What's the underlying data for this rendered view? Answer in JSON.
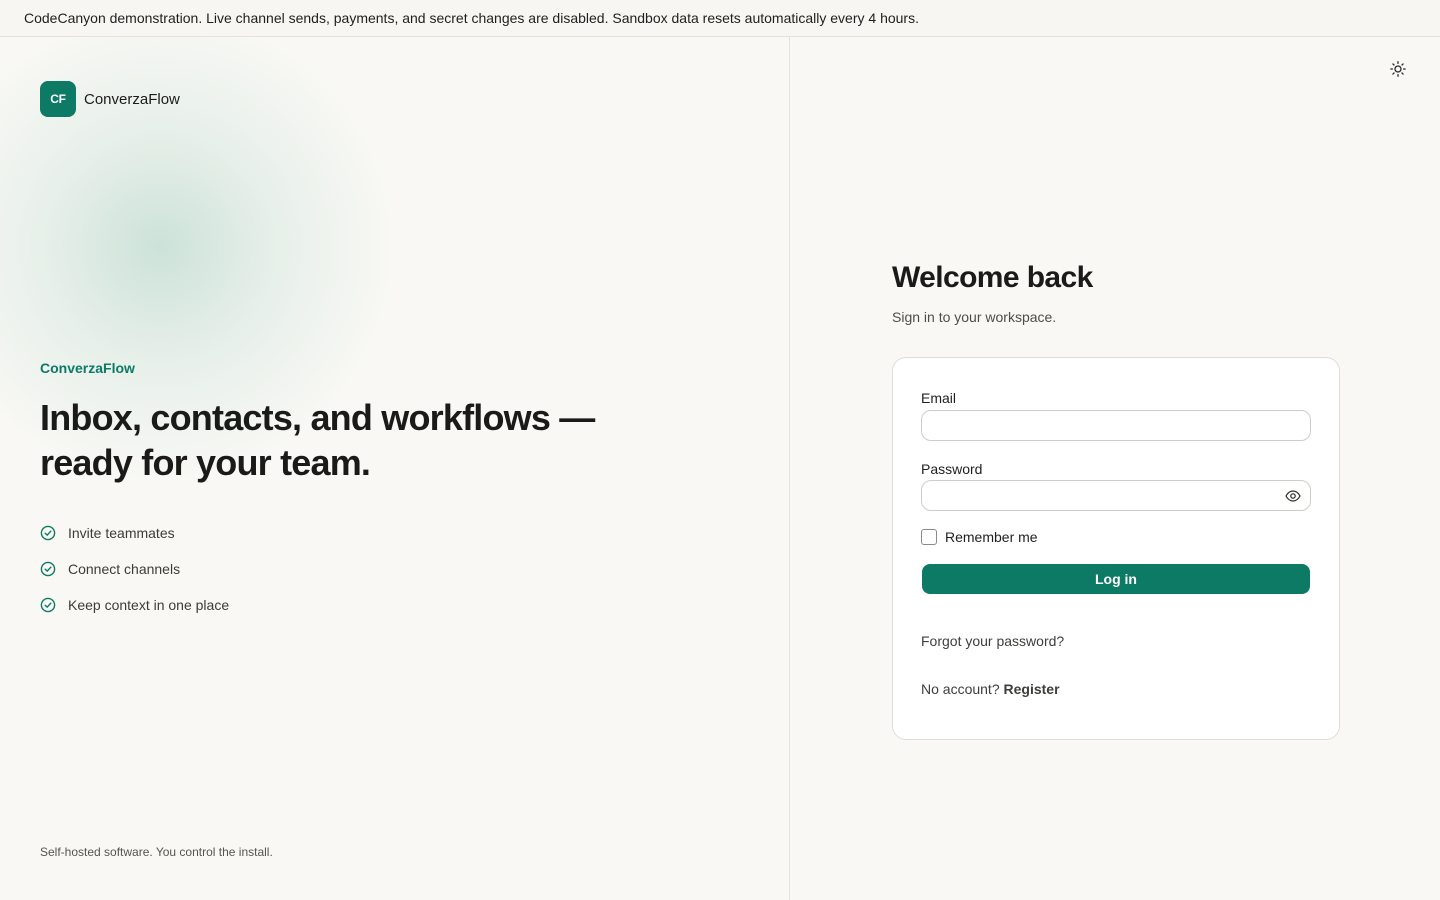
{
  "banner": {
    "text": "CodeCanyon demonstration. Live channel sends, payments, and secret changes are disabled. Sandbox data resets automatically every 4 hours."
  },
  "brand": {
    "logo_text": "CF",
    "name": "ConverzaFlow",
    "accent_color": "#0d7a66"
  },
  "hero": {
    "eyebrow": "ConverzaFlow",
    "headline": "Inbox, contacts, and workflows — ready for your team.",
    "features": [
      {
        "icon": "check-circle-icon",
        "label": "Invite teammates"
      },
      {
        "icon": "check-circle-icon",
        "label": "Connect channels"
      },
      {
        "icon": "check-circle-icon",
        "label": "Keep context in one place"
      }
    ],
    "footnote": "Self-hosted software. You control the install."
  },
  "header": {
    "theme_toggle_icon": "sun-icon"
  },
  "login": {
    "title": "Welcome back",
    "subtitle": "Sign in to your workspace.",
    "email_label": "Email",
    "email_value": "",
    "password_label": "Password",
    "password_value": "",
    "password_toggle_icon": "eye-icon",
    "remember_label": "Remember me",
    "remember_checked": false,
    "submit_label": "Log in",
    "forgot_label": "Forgot your password?",
    "no_account_text": "No account?",
    "register_label": "Register"
  }
}
